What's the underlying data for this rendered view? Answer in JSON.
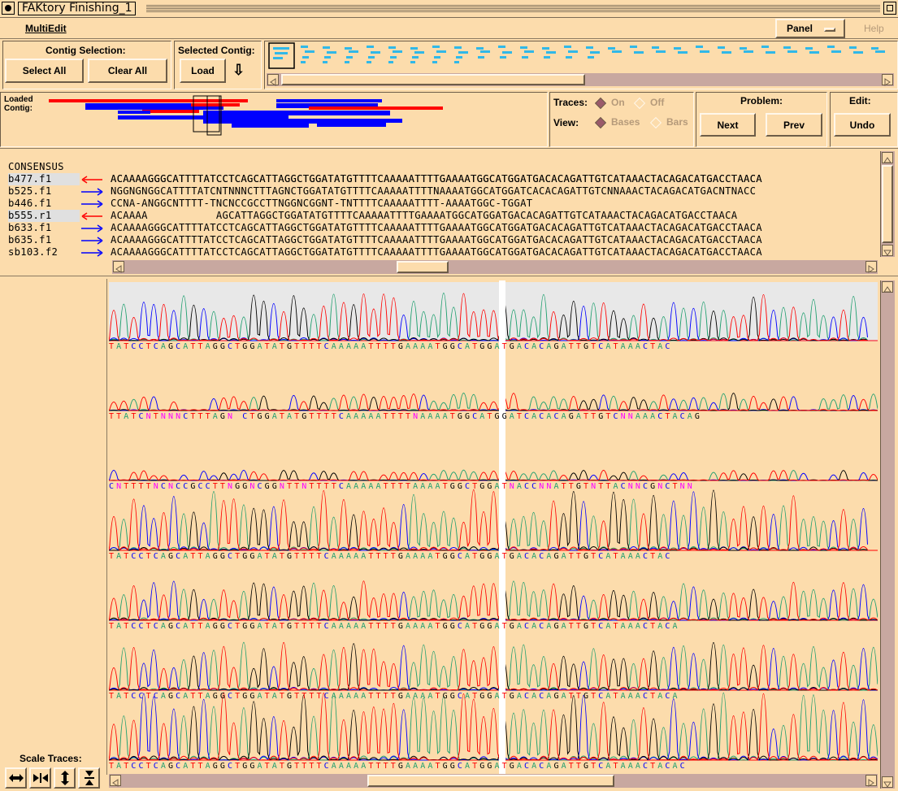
{
  "window": {
    "title": "FAKtory Finishing_1"
  },
  "menu": {
    "multiedit": "MultiEdit",
    "panel": "Panel",
    "help": "Help"
  },
  "contig_selection": {
    "title": "Contig Selection:",
    "select_all": "Select All",
    "clear_all": "Clear All"
  },
  "selected_contig": {
    "title": "Selected Contig:",
    "load": "Load",
    "arrow": "⇩"
  },
  "overview": {
    "loaded_label": "Loaded",
    "contig_label": "Contig:"
  },
  "traces": {
    "label": "Traces:",
    "on": "On",
    "off": "Off",
    "selected": "On"
  },
  "view": {
    "label": "View:",
    "bases": "Bases",
    "bars": "Bars",
    "selected": "Bases"
  },
  "problem": {
    "title": "Problem:",
    "next": "Next",
    "prev": "Prev"
  },
  "edit": {
    "title": "Edit:",
    "undo": "Undo"
  },
  "consensus": {
    "name": "CONSENSUS",
    "seq": "ACAAAAGGGCATTTTATCCTCAGCATTAGGCTGGATATGTTTTCAAAAATTTTGAAAATGGCATGGATGACACAGATTGTCATAAACTACAGACATGACCTAACA"
  },
  "reads": [
    {
      "name": "b477.f1",
      "dir": "reverse",
      "color": "#ff0000",
      "highlight": true,
      "seq": "ACAAAAGGGCATTTTATCCTCAGCATTAGGCTGGATATGTTTTCAAAAATTTTGAAAATGGCATGGATGACACAGATTGTCATAAACTACAGACATGACCTAACA"
    },
    {
      "name": "b525.f1",
      "dir": "forward",
      "color": "#0000ff",
      "highlight": false,
      "seq": "NGGNGNGGCATTTTATCNTNNNCTTTAGNCTGGATATGTTTTCAAAAATTTTNAAAATGGCATGGATCACACAGATTGTCNNAAACTACAGACATGACNTNACC"
    },
    {
      "name": "b446.f1",
      "dir": "forward",
      "color": "#0000ff",
      "highlight": false,
      "seq": "CCNA-ANGGCNTTTT-TNCNCCGCCTTNGGNCGGNT-TNTTTTCAAAAATTTT-AAAATGGC-TGGAT"
    },
    {
      "name": "b555.r1",
      "dir": "reverse",
      "color": "#ff0000",
      "highlight": true,
      "seq": "ACAAAA           AGCATTAGGCTGGATATGTTTTCAAAAATTTTGAAAATGGCATGGATGACACAGATTGTCATAAACTACAGACATGACCTAACA"
    },
    {
      "name": "b633.f1",
      "dir": "forward",
      "color": "#0000ff",
      "highlight": false,
      "seq": "ACAAAAGGGCATTTTATCCTCAGCATTAGGCTGGATATGTTTTCAAAAATTTTGAAAATGGCATGGATGACACAGATTGTCATAAACTACAGACATGACCTAACA"
    },
    {
      "name": "b635.f1",
      "dir": "forward",
      "color": "#0000ff",
      "highlight": false,
      "seq": "ACAAAAGGGCATTTTATCCTCAGCATTAGGCTGGATATGTTTTCAAAAATTTTGAAAATGGCATGGATGACACAGATTGTCATAAACTACAGACATGACCTAACA"
    },
    {
      "name": "sb103.f2",
      "dir": "forward",
      "color": "#0000ff",
      "highlight": false,
      "seq": "ACAAAAGGGCATTTTATCCTCAGCATTAGGCTGGATATGTTTTCAAAAATTTTGAAAATGGCATGGATGACACAGATTGTCATAAACTACAGACATGACCTAACA"
    }
  ],
  "trace_bases": [
    "TATCCTCAGCATTAGGCTGGATATGTTTTCAAAAATTTTGAAAATGGCATGGATGACACAGATTGTCATAAACTAC",
    "TTATCNTNNNCTTTAGN CTGGATATGTTTTCAAAAATTTTNAAAATGGCATGGATCACACAGATTGTCNNAAACTACAG",
    "CNTTTTNCNCCGCCTTNGGNCGGNTTNTTTTCAAAAATTTTAAAATGGCTGGATNACCNNATTGTNTTACNNCGNCTNN",
    "TATCCTCAGCATTAGGCTGGATATGTTTTCAAAAATTTTGAAAATGGCATGGATGACACAGATTGTCATAAACTAC",
    "TATCCTCAGCATTAGGCTGGATATGTTTTCAAAAATTTTGAAAATGGCATGGATGACACAGATTGTCATAAACTACA",
    "TATCCTCAGCATTAGGCTGGATATGTTTTCAAAAATTTTGAAAATGGCATGGATGACACAGATTGTCATAAACTACA",
    "TATCCTCAGCATTAGGCTGGATATGTTTTCAAAAATTTTGAAAATGGCATGGATGACACAGATTGTCATAAACTACAC"
  ],
  "base_colors": {
    "A": "#20a070",
    "C": "#0000ff",
    "G": "#000000",
    "T": "#ff0000",
    "N": "#ff00ff"
  },
  "scale_traces": {
    "label": "Scale Traces:"
  }
}
